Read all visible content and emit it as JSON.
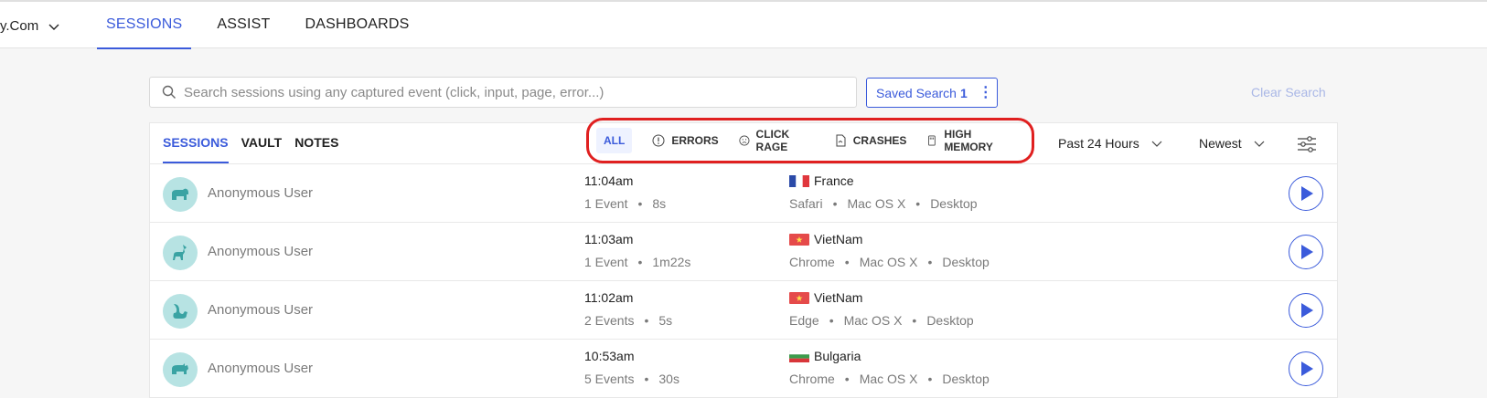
{
  "header": {
    "project": "y.Com",
    "nav": [
      "SESSIONS",
      "ASSIST",
      "DASHBOARDS"
    ],
    "active_nav": "SESSIONS"
  },
  "search": {
    "placeholder": "Search sessions using any captured event (click, input, page, error...)",
    "value": ""
  },
  "saved_search": {
    "label": "Saved Search",
    "count": "1"
  },
  "clear_search": "Clear Search",
  "tabs": [
    "SESSIONS",
    "VAULT",
    "NOTES"
  ],
  "filters": [
    {
      "label": "ALL",
      "icon": "none",
      "active": true
    },
    {
      "label": "ERRORS",
      "icon": "exclamation-circle-icon"
    },
    {
      "label": "CLICK RAGE",
      "icon": "frown-face-icon"
    },
    {
      "label": "CRASHES",
      "icon": "crash-file-icon"
    },
    {
      "label": "HIGH MEMORY",
      "icon": "memory-card-icon"
    }
  ],
  "time_range": "Past 24 Hours",
  "sort": "Newest",
  "sessions": [
    {
      "avatar": "bear-icon",
      "user": "Anonymous User",
      "time": "11:04am",
      "events": "1 Event",
      "duration": "8s",
      "country": "France",
      "browser": "Safari",
      "os": "Mac OS X",
      "device": "Desktop"
    },
    {
      "avatar": "horse-icon",
      "user": "Anonymous User",
      "time": "11:03am",
      "events": "1 Event",
      "duration": "1m22s",
      "country": "VietNam",
      "browser": "Chrome",
      "os": "Mac OS X",
      "device": "Desktop"
    },
    {
      "avatar": "squirrel-icon",
      "user": "Anonymous User",
      "time": "11:02am",
      "events": "2 Events",
      "duration": "5s",
      "country": "VietNam",
      "browser": "Edge",
      "os": "Mac OS X",
      "device": "Desktop"
    },
    {
      "avatar": "rhino-icon",
      "user": "Anonymous User",
      "time": "10:53am",
      "events": "5 Events",
      "duration": "30s",
      "country": "Bulgaria",
      "browser": "Chrome",
      "os": "Mac OS X",
      "device": "Desktop"
    }
  ],
  "colors": {
    "accent": "#3b5bdb",
    "highlight": "#e02020",
    "avatar_bg": "#b7e3e3",
    "avatar_fg": "#3aa3a3"
  }
}
